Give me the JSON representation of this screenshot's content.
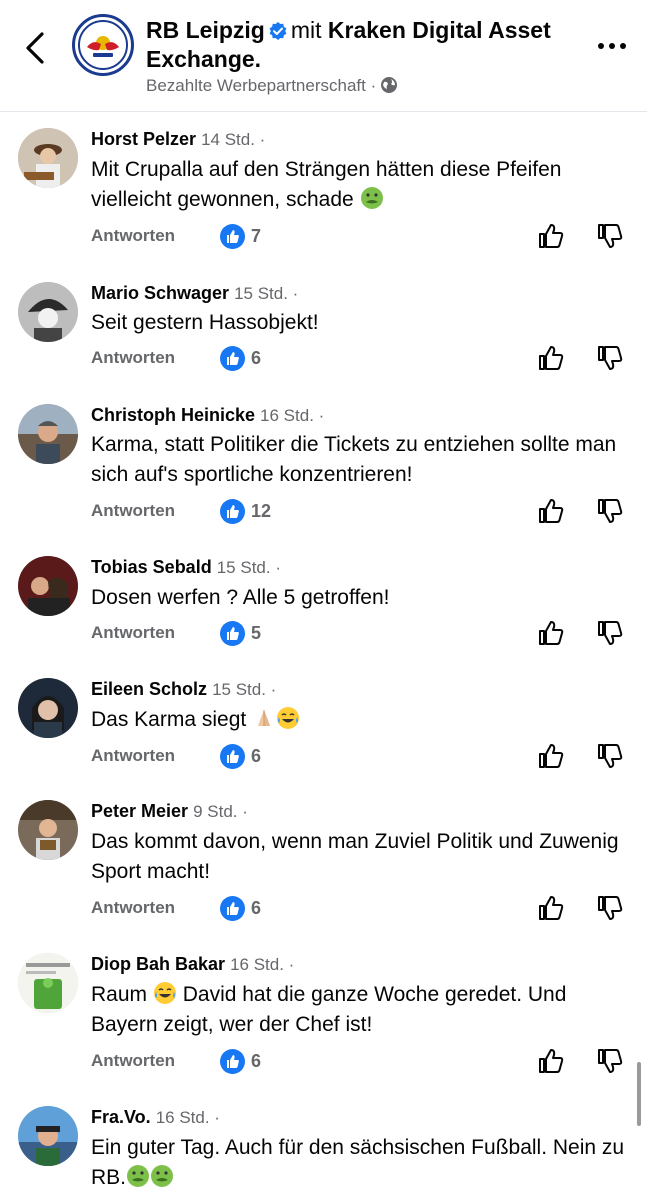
{
  "header": {
    "page_name": "RB Leipzig",
    "mit": "mit",
    "partner": "Kraken Digital Asset Exchange.",
    "subtitle": "Bezahlte Werbepartnerschaft ·"
  },
  "colors": {
    "accent": "#1877f2",
    "secondary_text": "#65676b",
    "text": "#050505"
  },
  "comments": [
    {
      "name": "Horst Pelzer",
      "time": "14 Std. ·",
      "text": "Mit Crupalla auf den Strängen hätten diese Pfeifen vielleicht gewonnen, schade",
      "reply": "Antworten",
      "likes": "7",
      "emojis": [
        "nauseated-face"
      ]
    },
    {
      "name": "Mario Schwager",
      "time": "15 Std. ·",
      "text": "Seit gestern Hassobjekt!",
      "reply": "Antworten",
      "likes": "6",
      "emojis": []
    },
    {
      "name": "Christoph Heinicke",
      "time": "16 Std. ·",
      "text": "Karma, statt Politiker die Tickets zu entziehen sollte man sich auf's sportliche konzentrieren!",
      "reply": "Antworten",
      "likes": "12",
      "emojis": []
    },
    {
      "name": "Tobias Sebald",
      "time": "15 Std. ·",
      "text": "Dosen werfen ? Alle 5 getroffen!",
      "reply": "Antworten",
      "likes": "5",
      "emojis": []
    },
    {
      "name": "Eileen Scholz",
      "time": "15 Std. ·",
      "text": "Das Karma siegt",
      "reply": "Antworten",
      "likes": "6",
      "emojis": [
        "folded-hands",
        "tears-of-joy"
      ]
    },
    {
      "name": "Peter Meier",
      "time": "9 Std. ·",
      "text": "Das kommt davon, wenn man Zuviel Politik und Zuwenig Sport macht!",
      "reply": "Antworten",
      "likes": "6",
      "emojis": []
    },
    {
      "name": "Diop Bah Bakar",
      "time": "16 Std. ·",
      "text_before": "Raum",
      "text_after": "David hat die ganze Woche geredet. Und Bayern zeigt, wer der Chef ist!",
      "reply": "Antworten",
      "likes": "6",
      "emojis": [
        "tears-of-joy"
      ]
    },
    {
      "name": "Fra.Vo.",
      "time": "16 Std. ·",
      "text": "Ein guter Tag. Auch für den sächsischen Fußball. Nein zu RB.",
      "emojis": [
        "nauseated-face",
        "nauseated-face"
      ]
    }
  ]
}
